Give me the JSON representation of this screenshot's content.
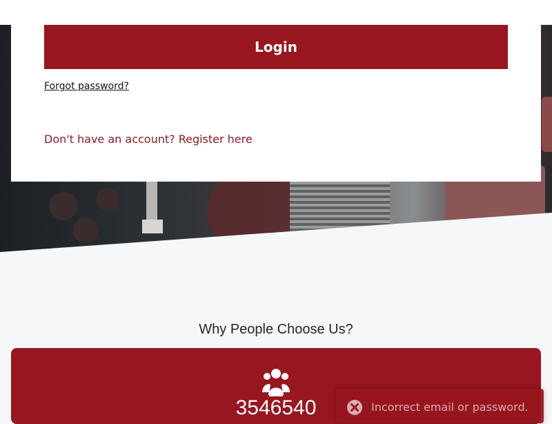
{
  "login_form": {
    "login_button_label": "Login",
    "forgot_password_link": "Forgot password?",
    "register_link": "Don't have an account? Register here"
  },
  "features": {
    "section_title": "Why People Choose Us?",
    "cards": [
      {
        "icon": "users-icon",
        "value": "3546540"
      }
    ]
  },
  "toast": {
    "icon": "close-circle-icon",
    "message": "Incorrect email or password."
  },
  "colors": {
    "brand_red": "#97161f",
    "page_background": "#f6f7f9"
  }
}
